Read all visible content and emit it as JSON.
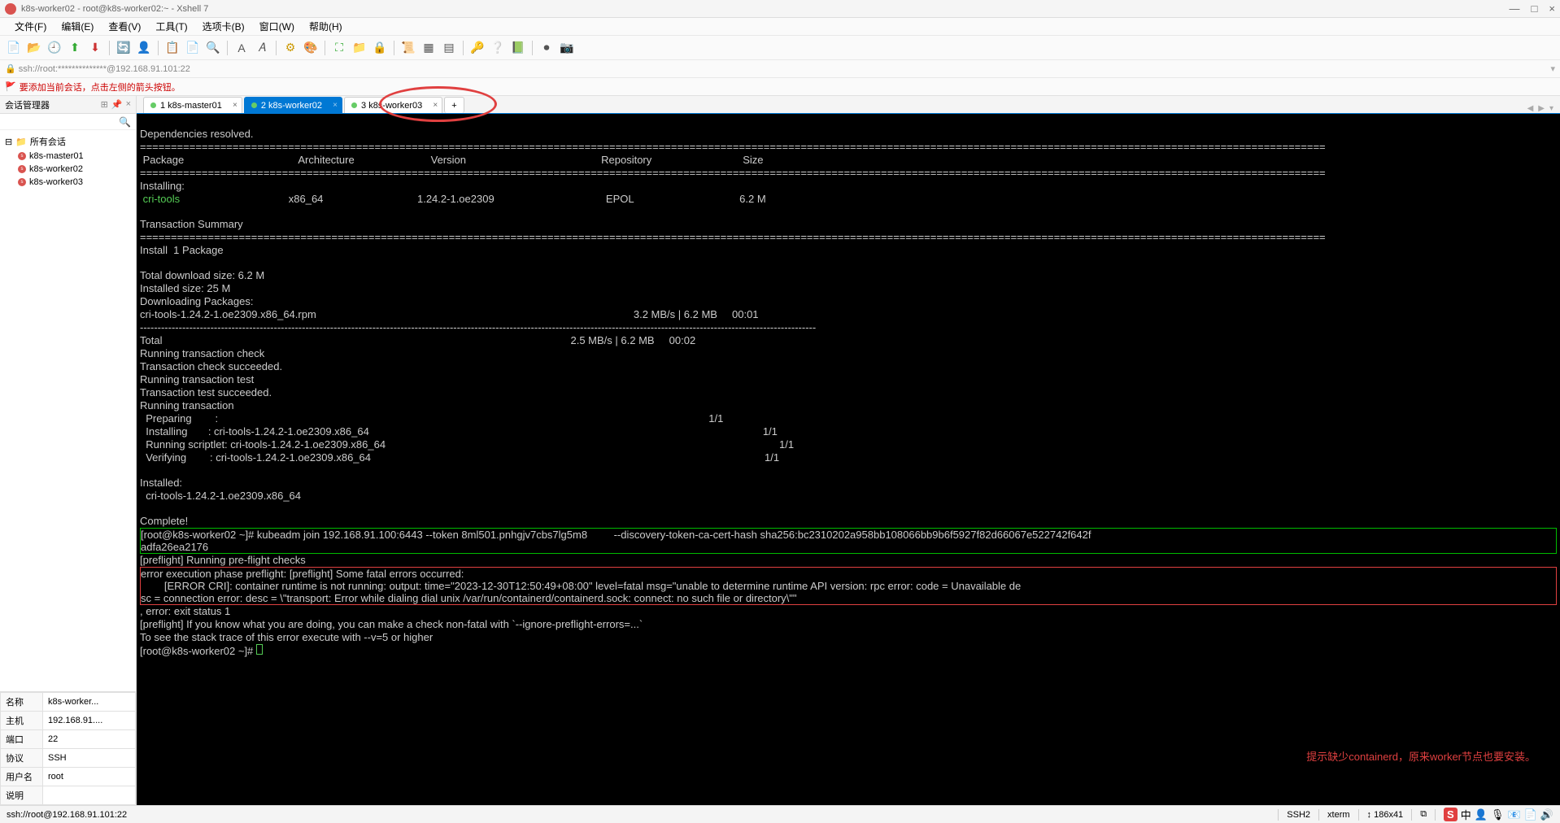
{
  "window": {
    "title": "k8s-worker02 - root@k8s-worker02:~ - Xshell 7",
    "minimize": "—",
    "maximize": "□",
    "close": "×"
  },
  "menu": [
    "文件(F)",
    "编辑(E)",
    "查看(V)",
    "工具(T)",
    "选项卡(B)",
    "窗口(W)",
    "帮助(H)"
  ],
  "addressbar": "🔒 ssh://root:**************@192.168.91.101:22",
  "hint": "要添加当前会话，点击左侧的箭头按钮。",
  "sidebar": {
    "header": "会话管理器",
    "root": "所有会话",
    "items": [
      "k8s-master01",
      "k8s-worker02",
      "k8s-worker03"
    ]
  },
  "props": {
    "rows": [
      {
        "k": "名称",
        "v": "k8s-worker..."
      },
      {
        "k": "主机",
        "v": "192.168.91...."
      },
      {
        "k": "端口",
        "v": "22"
      },
      {
        "k": "协议",
        "v": "SSH"
      },
      {
        "k": "用户名",
        "v": "root"
      },
      {
        "k": "说明",
        "v": ""
      }
    ]
  },
  "tabs": [
    {
      "label": "1 k8s-master01",
      "active": false
    },
    {
      "label": "2 k8s-worker02",
      "active": true
    },
    {
      "label": "3 k8s-worker03",
      "active": false
    }
  ],
  "terminal": {
    "line1": "Dependencies resolved.",
    "hrule": "================================================================================================================================================================================================",
    "cols": " Package                                       Architecture                          Version                                              Repository                               Size",
    "installing": "Installing:",
    "pkg": " cri-tools                                     x86_64                                1.24.2-1.oe2309                                      EPOL                                    6.2 M",
    "txsum": "Transaction Summary",
    "inst1": "Install  1 Package",
    "dl1": "Total download size: 6.2 M",
    "dl2": "Installed size: 25 M",
    "dl3": "Downloading Packages:",
    "dl4": "cri-tools-1.24.2-1.oe2309.x86_64.rpm                                                                                                            3.2 MB/s | 6.2 MB     00:01",
    "dashrule": "------------------------------------------------------------------------------------------------------------------------------------------------------------------------------------------------",
    "total": "Total                                                                                                                                           2.5 MB/s | 6.2 MB     00:02",
    "rt1": "Running transaction check",
    "rt2": "Transaction check succeeded.",
    "rt3": "Running transaction test",
    "rt4": "Transaction test succeeded.",
    "rt5": "Running transaction",
    "st1": "  Preparing        :                                                                                                                                                                       1/1",
    "st2": "  Installing       : cri-tools-1.24.2-1.oe2309.x86_64                                                                                                                                      1/1",
    "st3": "  Running scriptlet: cri-tools-1.24.2-1.oe2309.x86_64                                                                                                                                      1/1",
    "st4": "  Verifying        : cri-tools-1.24.2-1.oe2309.x86_64                                                                                                                                      1/1",
    "inst2": "Installed:",
    "inst3": "  cri-tools-1.24.2-1.oe2309.x86_64",
    "complete": "Complete!",
    "cmd1a": "[root@k8s-worker02 ~]# kubeadm join 192.168.91.100:6443 --token 8ml501.pnhgjv7cbs7lg5m8         --discovery-token-ca-cert-hash sha256:bc2310202a958bb108066bb9b6f5927f82d66067e522742f642f",
    "cmd1b": "adfa26ea2176",
    "pf1": "[preflight] Running pre-flight checks",
    "err1": "error execution phase preflight: [preflight] Some fatal errors occurred:",
    "err2": "        [ERROR CRI]: container runtime is not running: output: time=\"2023-12-30T12:50:49+08:00\" level=fatal msg=\"unable to determine runtime API version: rpc error: code = Unavailable de",
    "err3": "sc = connection error: desc = \\\"transport: Error while dialing dial unix /var/run/containerd/containerd.sock: connect: no such file or directory\\\"\"",
    "err4": ", error: exit status 1",
    "pf2": "[preflight] If you know what you are doing, you can make a check non-fatal with `--ignore-preflight-errors=...`",
    "pf3": "To see the stack trace of this error execute with --v=5 or higher",
    "prompt": "[root@k8s-worker02 ~]# ",
    "annotation": "提示缺少containerd，原来worker节点也要安装。"
  },
  "status": {
    "left": "ssh://root@192.168.91.101:22",
    "r1": "SSH2",
    "r2": "xterm",
    "r3": "↕ 186x41",
    "r4": "⧉"
  },
  "tray": {
    "ime": "中",
    "items": [
      "👤",
      "🎙",
      "📧",
      "📄",
      "🔊"
    ]
  }
}
